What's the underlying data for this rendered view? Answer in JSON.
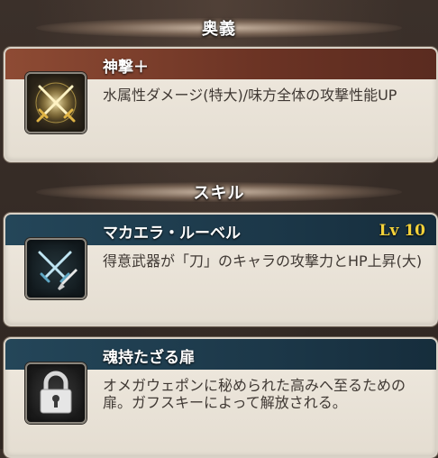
{
  "ougi": {
    "section_title": "奥義",
    "name": "神撃＋",
    "description": "水属性ダメージ(特大)/味方全体の攻撃性能UP",
    "icon": "golden-crossed-swords-icon"
  },
  "skill": {
    "section_title": "スキル",
    "items": [
      {
        "name": "マカエラ・ルーベル",
        "level": "Lv 10",
        "description": "得意武器が「刀」のキャラの攻撃力とHP上昇(大)",
        "icon": "crossed-swords-icon"
      },
      {
        "name": "魂持たざる扉",
        "description": "オメガウェポンに秘められた高みへ至るための扉。ガフスキーによって解放される。",
        "icon": "padlock-icon"
      }
    ]
  },
  "colors": {
    "ougi_header": "#8e4b34",
    "skill_header": "#244659",
    "level_text": "#f4d23a"
  }
}
